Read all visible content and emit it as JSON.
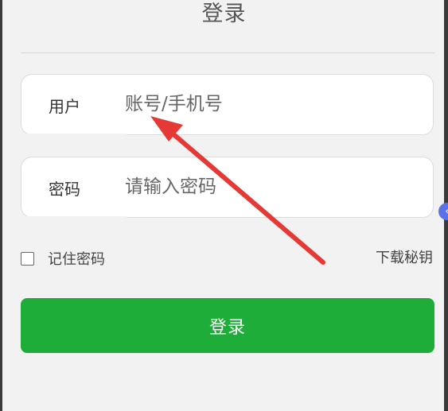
{
  "header": {
    "title": "登录"
  },
  "form": {
    "user": {
      "label": "用户",
      "placeholder": "账号/手机号",
      "value": ""
    },
    "password": {
      "label": "密码",
      "placeholder": "请输入密码",
      "value": ""
    },
    "remember": {
      "label": "记住密码",
      "checked": false
    },
    "download_link": "下载秘钥",
    "submit_label": "登录"
  },
  "colors": {
    "primary": "#1fad3a",
    "annotation_arrow": "#e53935",
    "background": "#f2f2f2"
  },
  "icons": {
    "side_tab": "chevron-left-icon"
  }
}
